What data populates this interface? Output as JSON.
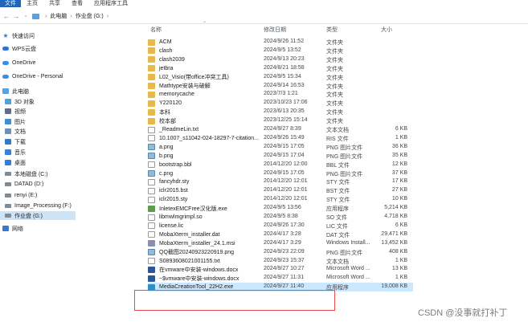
{
  "ribbon": {
    "tabs": [
      "文件",
      "主页",
      "共享",
      "查看",
      "应用程序工具"
    ]
  },
  "address": {
    "crumbs": [
      "此电脑",
      "作业盘 (G:)"
    ]
  },
  "columns": {
    "name": "名称",
    "date": "修改日期",
    "type": "类型",
    "size": "大小"
  },
  "sidebar": {
    "items": [
      {
        "label": "快速访问",
        "icon": "star-icon"
      },
      {
        "label": "WPS云盘",
        "icon": "wps-cloud-icon"
      },
      {
        "label": "OneDrive",
        "icon": "onedrive-icon"
      },
      {
        "label": "OneDrive - Personal",
        "icon": "onedrive-icon"
      },
      {
        "label": "此电脑",
        "icon": "pc-icon"
      },
      {
        "label": "3D 对象",
        "icon": "objects3d-icon"
      },
      {
        "label": "视频",
        "icon": "video-icon"
      },
      {
        "label": "图片",
        "icon": "pictures-icon"
      },
      {
        "label": "文档",
        "icon": "documents-icon"
      },
      {
        "label": "下载",
        "icon": "downloads-icon"
      },
      {
        "label": "音乐",
        "icon": "music-icon"
      },
      {
        "label": "桌面",
        "icon": "desktop-icon"
      },
      {
        "label": "本地磁盘 (C:)",
        "icon": "drive-icon"
      },
      {
        "label": "DATAD (D:)",
        "icon": "drive-icon"
      },
      {
        "label": "renyi (E:)",
        "icon": "drive-icon"
      },
      {
        "label": "Image_Processing (F:)",
        "icon": "drive-icon"
      },
      {
        "label": "作业盘 (G:)",
        "icon": "drive-icon"
      },
      {
        "label": "网络",
        "icon": "network-icon"
      }
    ]
  },
  "files": [
    {
      "name": "ACM",
      "date": "2024/9/26 11:52",
      "type": "文件夹",
      "size": "",
      "kind": "folder"
    },
    {
      "name": "clash",
      "date": "2024/9/5 13:52",
      "type": "文件夹",
      "size": "",
      "kind": "folder"
    },
    {
      "name": "clash2039",
      "date": "2024/9/13 20:23",
      "type": "文件夹",
      "size": "",
      "kind": "folder"
    },
    {
      "name": "jetbra",
      "date": "2024/8/21 18:58",
      "type": "文件夹",
      "size": "",
      "kind": "folder"
    },
    {
      "name": "L02_Visio(带office冲突工具)",
      "date": "2024/9/5 15:34",
      "type": "文件夹",
      "size": "",
      "kind": "folder"
    },
    {
      "name": "Mathtype安装与破解",
      "date": "2024/9/14 16:53",
      "type": "文件夹",
      "size": "",
      "kind": "folder"
    },
    {
      "name": "memorycache",
      "date": "2023/7/3 1:21",
      "type": "文件夹",
      "size": "",
      "kind": "folder"
    },
    {
      "name": "Y220120",
      "date": "2023/10/23 17:06",
      "type": "文件夹",
      "size": "",
      "kind": "folder"
    },
    {
      "name": "本科",
      "date": "2023/6/13 20:35",
      "type": "文件夹",
      "size": "",
      "kind": "folder"
    },
    {
      "name": "校本部",
      "date": "2023/12/25 15:14",
      "type": "文件夹",
      "size": "",
      "kind": "folder"
    },
    {
      "name": "_ReadmeLin.txt",
      "date": "2024/9/27 8:39",
      "type": "文本文档",
      "size": "6 KB",
      "kind": "txt"
    },
    {
      "name": "10.1007_s11042-024-18297-7-citation...",
      "date": "2024/9/26 15:49",
      "type": "RIS 文件",
      "size": "1 KB",
      "kind": "txt"
    },
    {
      "name": "a.png",
      "date": "2024/9/15 17:05",
      "type": "PNG 图片文件",
      "size": "36 KB",
      "kind": "png"
    },
    {
      "name": "b.png",
      "date": "2024/9/15 17:04",
      "type": "PNG 图片文件",
      "size": "35 KB",
      "kind": "png"
    },
    {
      "name": "bootstrap.bbl",
      "date": "2014/12/20 12:00",
      "type": "BBL 文件",
      "size": "12 KB",
      "kind": "bbl"
    },
    {
      "name": "c.png",
      "date": "2024/9/15 17:05",
      "type": "PNG 图片文件",
      "size": "37 KB",
      "kind": "png"
    },
    {
      "name": "fancyhdr.sty",
      "date": "2014/12/20 12:01",
      "type": "STY 文件",
      "size": "17 KB",
      "kind": "sty"
    },
    {
      "name": "iclr2015.bst",
      "date": "2014/12/20 12:01",
      "type": "BST 文件",
      "size": "27 KB",
      "kind": "sty"
    },
    {
      "name": "iclr2015.sty",
      "date": "2014/12/20 12:01",
      "type": "STY 文件",
      "size": "10 KB",
      "kind": "sty"
    },
    {
      "name": "InletexEMCFree汉化版.exe",
      "date": "2024/9/5 13:56",
      "type": "应用程序",
      "size": "5,214 KB",
      "kind": "exe"
    },
    {
      "name": "libmwlmgrimpl.so",
      "date": "2024/9/5 8:38",
      "type": "SO 文件",
      "size": "4,718 KB",
      "kind": "so"
    },
    {
      "name": "license.lic",
      "date": "2024/9/26 17:30",
      "type": "LIC 文件",
      "size": "6 KB",
      "kind": "txt"
    },
    {
      "name": "MobaXterm_installer.dat",
      "date": "2024/4/17 3:28",
      "type": "DAT 文件",
      "size": "29,471 KB",
      "kind": "dat"
    },
    {
      "name": "MobaXterm_installer_24.1.msi",
      "date": "2024/4/17 3:29",
      "type": "Windows Install...",
      "size": "13,452 KB",
      "kind": "msi"
    },
    {
      "name": "QQ截图20240923220919.png",
      "date": "2024/9/23 22:09",
      "type": "PNG 图片文件",
      "size": "408 KB",
      "kind": "png"
    },
    {
      "name": "S0893608021001155.txt",
      "date": "2024/9/23 15:37",
      "type": "文本文档",
      "size": "1 KB",
      "kind": "txt"
    },
    {
      "name": "在vmware中安装-windows.docx",
      "date": "2024/9/27 10:27",
      "type": "Microsoft Word ...",
      "size": "13 KB",
      "kind": "docx"
    },
    {
      "name": "~$vmware中安装-windows.docx",
      "date": "2024/9/27 11:31",
      "type": "Microsoft Word ...",
      "size": "1 KB",
      "kind": "docx"
    },
    {
      "name": "MediaCreationTool_22H2.exe",
      "date": "2024/9/27 11:40",
      "type": "应用程序",
      "size": "19,008 KB",
      "kind": "mct"
    }
  ],
  "watermark": "CSDN @没事就打补丁"
}
